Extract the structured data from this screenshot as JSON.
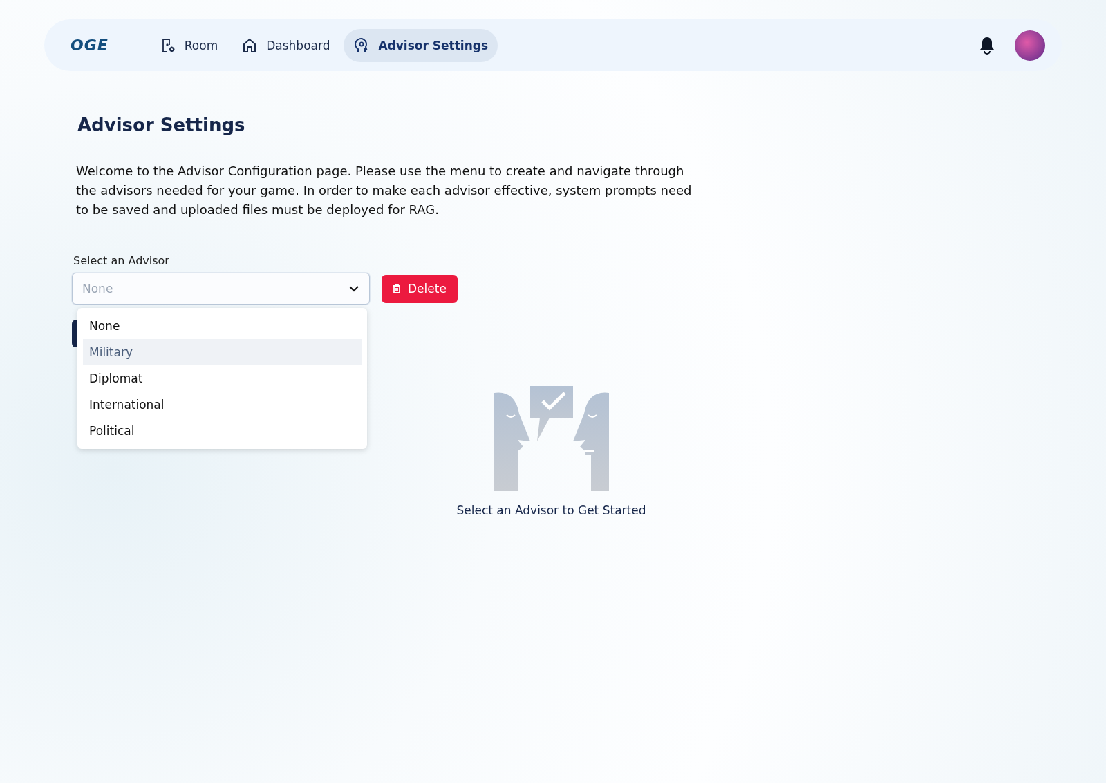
{
  "nav": {
    "logo": "OGE",
    "items": [
      {
        "label": "Room",
        "selected": false
      },
      {
        "label": "Dashboard",
        "selected": false
      },
      {
        "label": "Advisor Settings",
        "selected": true
      }
    ]
  },
  "page": {
    "title": "Advisor Settings",
    "intro": "Welcome to the Advisor Configuration page. Please  use the menu to create and navigate through the advisors needed for your game. In order to make each advisor effective, system prompts need to be saved and uploaded files must be deployed for RAG.",
    "select": {
      "label": "Select an Advisor",
      "placeholder": "None",
      "expanded": true,
      "options": [
        {
          "label": "None",
          "selected": false
        },
        {
          "label": "Military",
          "selected": true
        },
        {
          "label": "Diplomat",
          "selected": false
        },
        {
          "label": "International",
          "selected": false
        },
        {
          "label": "Political",
          "selected": false
        }
      ]
    },
    "delete_button": "Delete",
    "empty_state": "Select an Advisor to Get Started"
  }
}
